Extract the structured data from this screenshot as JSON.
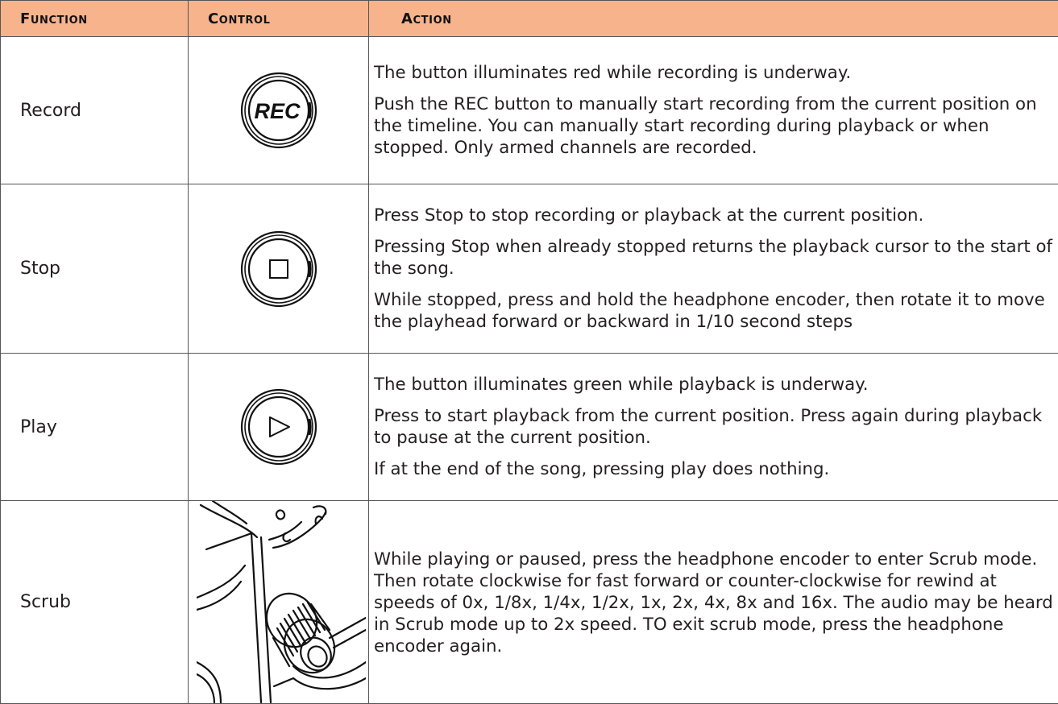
{
  "header": {
    "function": "Function",
    "control": "Control",
    "action": "Action"
  },
  "rows": [
    {
      "function": "Record",
      "control_icon": "rec-button-icon",
      "control_label": "REC",
      "actions": [
        "The button illuminates red while recording is underway.",
        "Push the REC button to manually start recording from the current position on the timeline. You can manually start recording during playback or when stopped. Only armed channels are recorded."
      ]
    },
    {
      "function": "Stop",
      "control_icon": "stop-button-icon",
      "actions": [
        "Press Stop to stop recording or playback at the current position.",
        "Pressing Stop when already stopped returns the playback cursor to the start of the song.",
        "While stopped, press and hold the headphone encoder, then rotate it to move the playhead forward or backward in 1/10 second steps"
      ]
    },
    {
      "function": "Play",
      "control_icon": "play-button-icon",
      "actions": [
        "The button illuminates green while playback is underway.",
        "Press to start playback from the current position. Press again during playback to pause at the current position.",
        "If at the end of the song, pressing play does nothing."
      ]
    },
    {
      "function": "Scrub",
      "control_icon": "headphone-encoder-knob-icon",
      "actions": [
        "While playing or paused, press the headphone encoder to enter Scrub mode. Then rotate clockwise for fast forward or counter-clockwise for rewind at speeds of 0x, 1/8x, 1/4x, 1/2x, 1x, 2x, 4x, 8x and 16x. The audio may be heard in Scrub mode up to 2x speed. TO exit scrub mode, press the headphone encoder again."
      ]
    }
  ],
  "colors": {
    "header_background": "#f7b38c",
    "border": "#555555",
    "text": "#231f20"
  }
}
